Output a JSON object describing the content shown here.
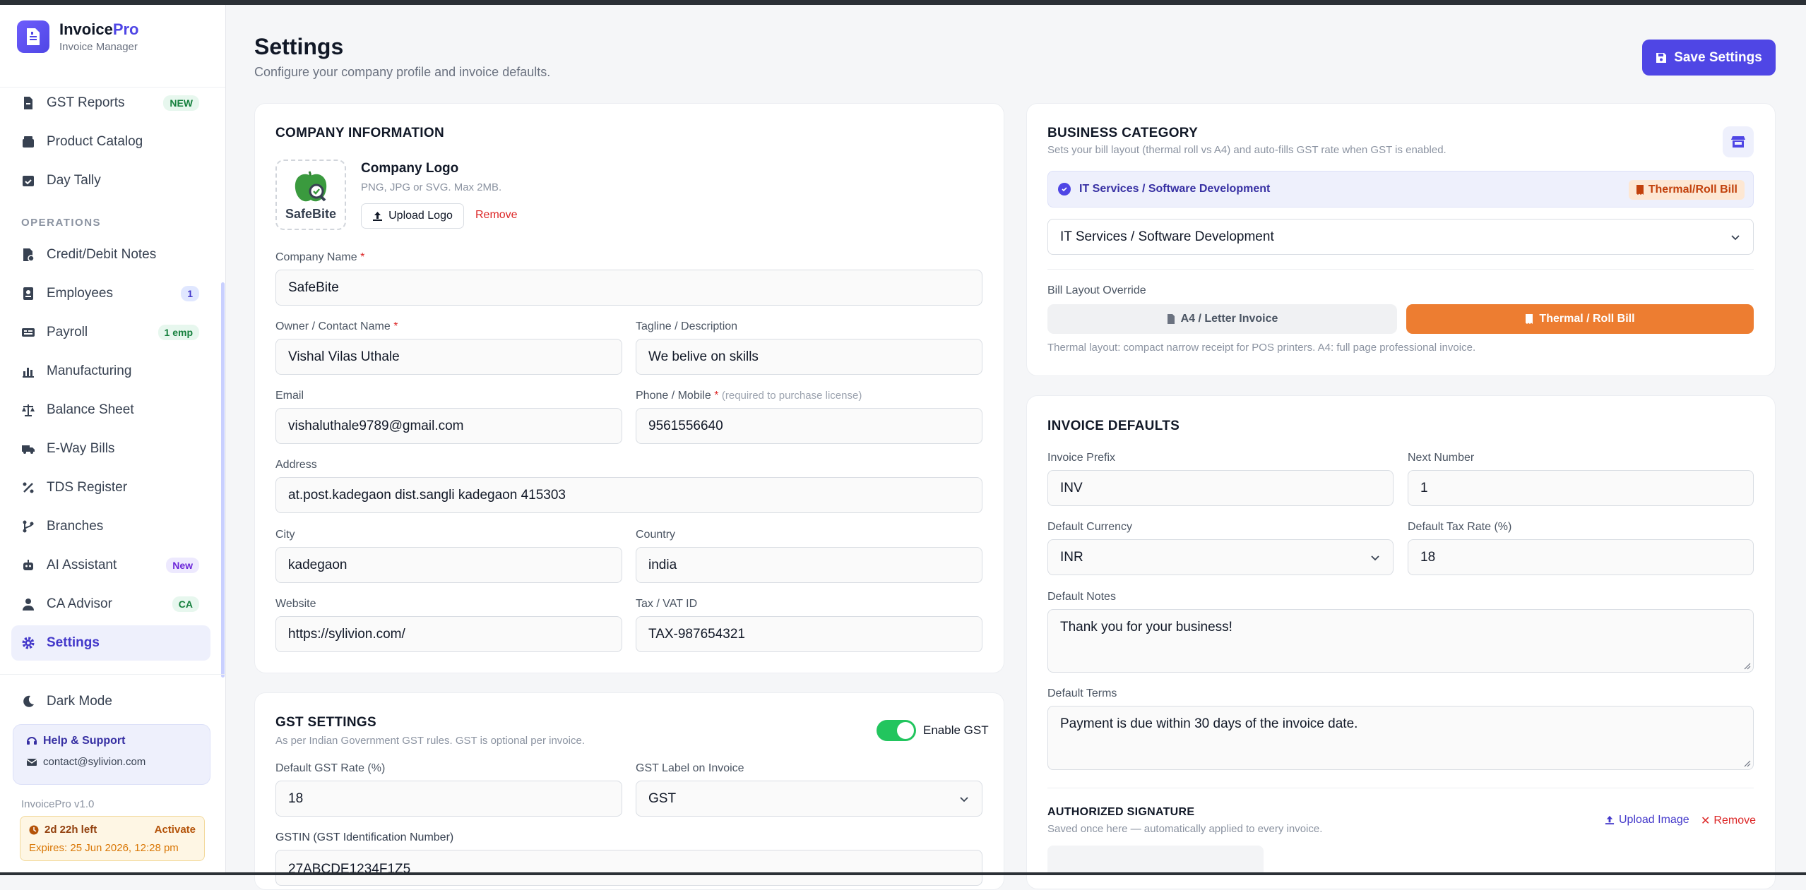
{
  "brand": {
    "name_main": "Invoice",
    "name_accent": "Pro",
    "subtitle": "Invoice Manager"
  },
  "sidebar": {
    "items_top": [
      {
        "label": "GST Reports",
        "badge": "NEW"
      },
      {
        "label": "Product Catalog"
      },
      {
        "label": "Day Tally"
      }
    ],
    "section_label": "OPERATIONS",
    "items_ops": [
      {
        "label": "Credit/Debit Notes"
      },
      {
        "label": "Employees",
        "badge": "1"
      },
      {
        "label": "Payroll",
        "badge": "1 emp"
      },
      {
        "label": "Manufacturing"
      },
      {
        "label": "Balance Sheet"
      },
      {
        "label": "E-Way Bills"
      },
      {
        "label": "TDS Register"
      },
      {
        "label": "Branches"
      },
      {
        "label": "AI Assistant",
        "badge": "New"
      },
      {
        "label": "CA Advisor",
        "badge": "CA"
      },
      {
        "label": "Settings"
      }
    ],
    "dark_mode": "Dark Mode",
    "help_title": "Help & Support",
    "help_email": "contact@sylivion.com",
    "version": "InvoicePro v1.0",
    "trial_left": "2d 22h left",
    "trial_action": "Activate",
    "trial_expires": "Expires: 25 Jun 2026, 12:28 pm"
  },
  "header": {
    "title": "Settings",
    "subtitle": "Configure your company profile and invoice defaults.",
    "save_label": "Save Settings"
  },
  "company": {
    "title": "COMPANY INFORMATION",
    "logo_label": "Company Logo",
    "logo_hint": "PNG, JPG or SVG. Max 2MB.",
    "logo_word": "SafeBite",
    "upload_label": "Upload Logo",
    "remove_label": "Remove",
    "name_label": "Company Name",
    "name": "SafeBite",
    "owner_label": "Owner / Contact Name",
    "owner": "Vishal Vilas Uthale",
    "tagline_label": "Tagline / Description",
    "tagline": "We belive on skills",
    "email_label": "Email",
    "email": "vishaluthale9789@gmail.com",
    "phone_label": "Phone / Mobile",
    "phone_hint": "(required to purchase license)",
    "phone": "9561556640",
    "address_label": "Address",
    "address": "at.post.kadegaon dist.sangli kadegaon 415303",
    "city_label": "City",
    "city": "kadegaon",
    "country_label": "Country",
    "country": "india",
    "website_label": "Website",
    "website": "https://sylivion.com/",
    "tax_label": "Tax / VAT ID",
    "tax": "TAX-987654321"
  },
  "gst": {
    "title": "GST SETTINGS",
    "subtitle": "As per Indian Government GST rules. GST is optional per invoice.",
    "enable_label": "Enable GST",
    "enabled": true,
    "rate_label": "Default GST Rate (%)",
    "rate": "18",
    "gst_label_label": "GST Label on Invoice",
    "gst_label": "GST",
    "gstin_label": "GSTIN (GST Identification Number)",
    "gstin": "27ABCDE1234F1Z5"
  },
  "business": {
    "title": "BUSINESS CATEGORY",
    "subtitle": "Sets your bill layout (thermal roll vs A4) and auto-fills GST rate when GST is enabled.",
    "selected": "IT Services / Software Development",
    "selected_tag": "Thermal/Roll Bill",
    "dropdown_value": "IT Services / Software Development",
    "override_label": "Bill Layout Override",
    "layout_a4": "A4 / Letter Invoice",
    "layout_thermal": "Thermal / Roll Bill",
    "layout_hint": "Thermal layout: compact narrow receipt for POS printers. A4: full page professional invoice."
  },
  "invoice": {
    "title": "INVOICE DEFAULTS",
    "prefix_label": "Invoice Prefix",
    "prefix": "INV",
    "next_label": "Next Number",
    "next": "1",
    "currency_label": "Default Currency",
    "currency": "INR",
    "tax_rate_label": "Default Tax Rate (%)",
    "tax_rate": "18",
    "notes_label": "Default Notes",
    "notes": "Thank you for your business!",
    "terms_label": "Default Terms",
    "terms": "Payment is due within 30 days of the invoice date."
  },
  "signature": {
    "title": "AUTHORIZED SIGNATURE",
    "subtitle": "Saved once here — automatically applied to every invoice.",
    "upload_label": "Upload Image",
    "remove_label": "Remove"
  },
  "colors": {
    "accent": "#4f46e5",
    "thermal": "#ed7d31",
    "toggle_on": "#22c55e",
    "danger": "#dc2626"
  }
}
